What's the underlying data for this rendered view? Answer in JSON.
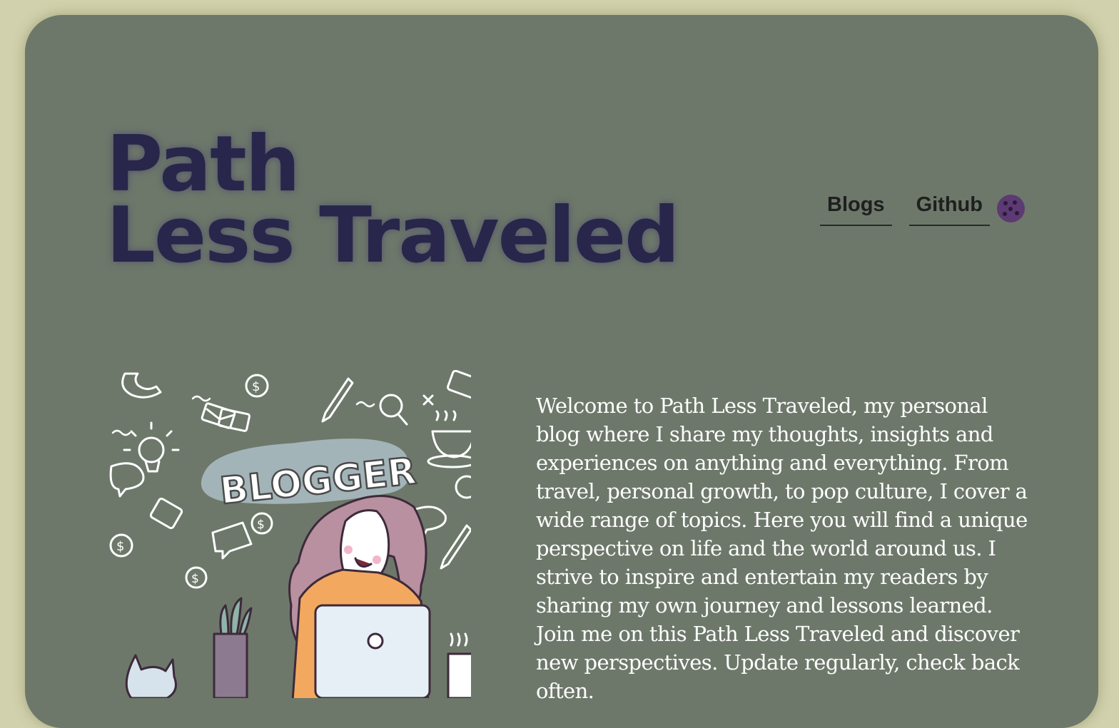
{
  "site": {
    "title_line1": "Path",
    "title_line2": "Less Traveled"
  },
  "nav": {
    "items": [
      {
        "label": "Blogs"
      },
      {
        "label": "Github"
      }
    ],
    "toggle_icon": "cookie-icon"
  },
  "hero": {
    "image_icon": "blogger-illustration",
    "badge_text": "BLOGGER",
    "intro": "Welcome to Path Less Traveled, my personal blog where I share my thoughts, insights and experiences on anything and everything. From travel, personal growth, to pop culture, I cover a wide range of topics. Here you will find a unique perspective on life and the world around us. I strive to inspire and entertain my readers by sharing my own journey and lessons learned. Join me on this Path Less Traveled and discover new perspectives. Update regularly, check back often."
  },
  "colors": {
    "page_bg": "#d1d2ad",
    "card_bg": "#6d786a",
    "title": "#28264a",
    "toggle": "#5d3a73"
  }
}
